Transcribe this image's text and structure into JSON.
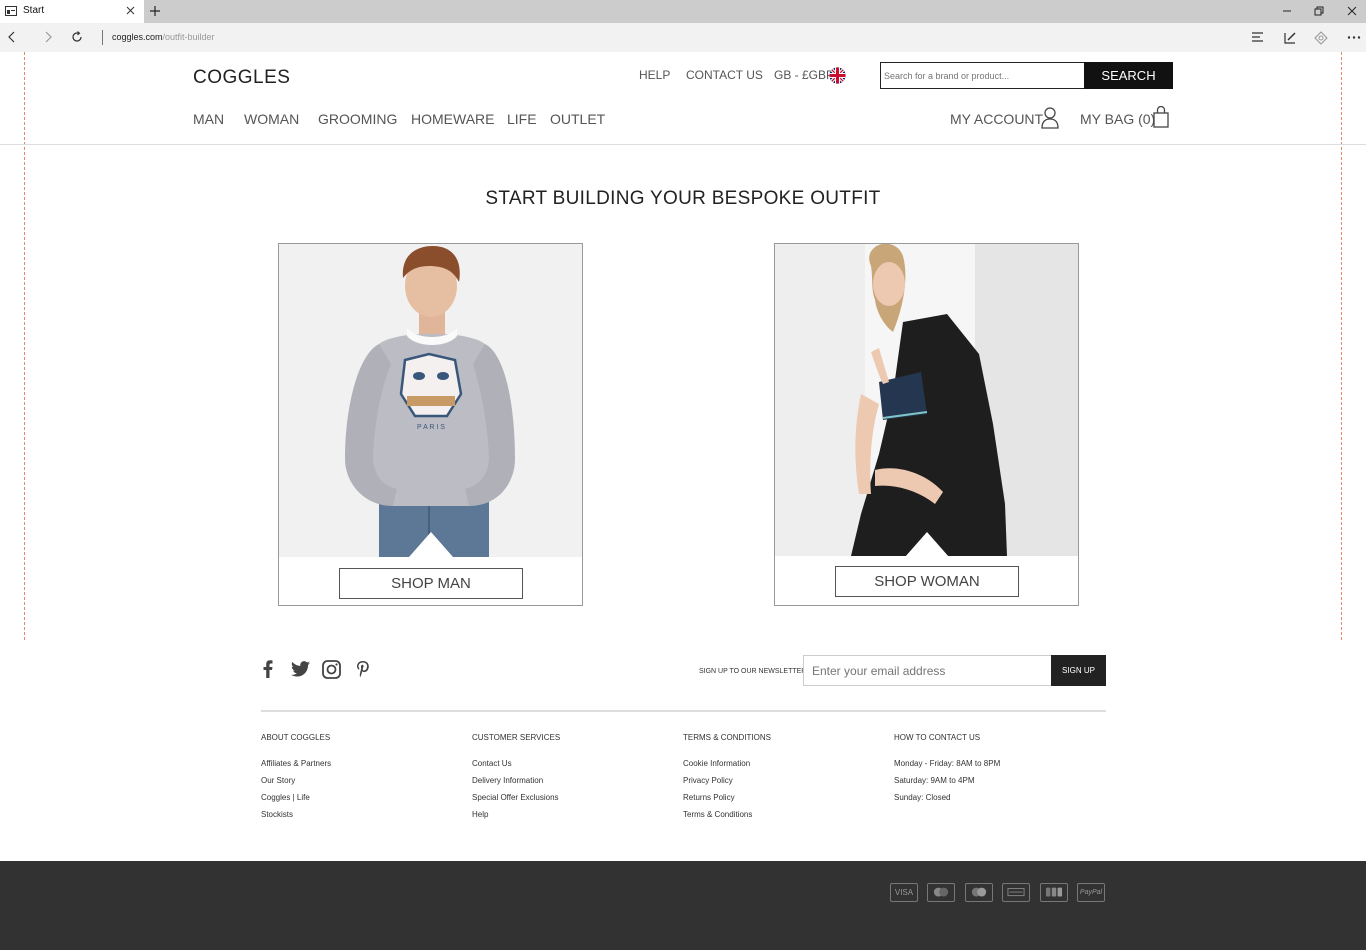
{
  "browser": {
    "tab_title": "Start",
    "url_domain": "coggles.com",
    "url_path": "/outfit-builder"
  },
  "header": {
    "logo": "COGGLES",
    "help": "HELP",
    "contact": "CONTACT US",
    "currency": "GB - £GBP",
    "search_placeholder": "Search for a brand or product...",
    "search_button": "SEARCH",
    "account": "MY ACCOUNT",
    "bag": "MY BAG (0)"
  },
  "nav": [
    "MAN",
    "WOMAN",
    "GROOMING",
    "HOMEWARE",
    "LIFE",
    "OUTLET"
  ],
  "main": {
    "title": "START BUILDING YOUR BESPOKE OUTFIT",
    "cards": [
      {
        "button": "SHOP MAN",
        "image": "man-model-photo"
      },
      {
        "button": "SHOP WOMAN",
        "image": "woman-model-photo"
      }
    ]
  },
  "footer": {
    "social": [
      "facebook-icon",
      "twitter-icon",
      "instagram-icon",
      "pinterest-icon"
    ],
    "newsletter_label": "SIGN UP TO OUR NEWSLETTER",
    "email_placeholder": "Enter your email address",
    "signup_button": "SIGN UP",
    "columns": [
      {
        "heading": "ABOUT COGGLES",
        "links": [
          "Affiliates & Partners",
          "Our Story",
          "Coggles | Life",
          "Stockists"
        ]
      },
      {
        "heading": "CUSTOMER SERVICES",
        "links": [
          "Contact Us",
          "Delivery Information",
          "Special Offer Exclusions",
          "Help"
        ]
      },
      {
        "heading": "TERMS & CONDITIONS",
        "links": [
          "Cookie Information",
          "Privacy Policy",
          "Returns Policy",
          "Terms & Conditions"
        ]
      },
      {
        "heading": "HOW TO CONTACT US",
        "links": [
          "Monday - Friday: 8AM to 8PM",
          "Saturday: 9AM to 4PM",
          "Sunday: Closed"
        ]
      }
    ],
    "payments": {
      "visa": "VISA",
      "mastercard": "mastercard-icon",
      "maestro": "maestro-icon",
      "amex": "amex-icon",
      "jcb": "jcb-icon",
      "paypal": "PayPal"
    }
  },
  "colors": {
    "accent": "#111111",
    "footer_bg": "#323232",
    "guide_line": "#e8866a"
  }
}
